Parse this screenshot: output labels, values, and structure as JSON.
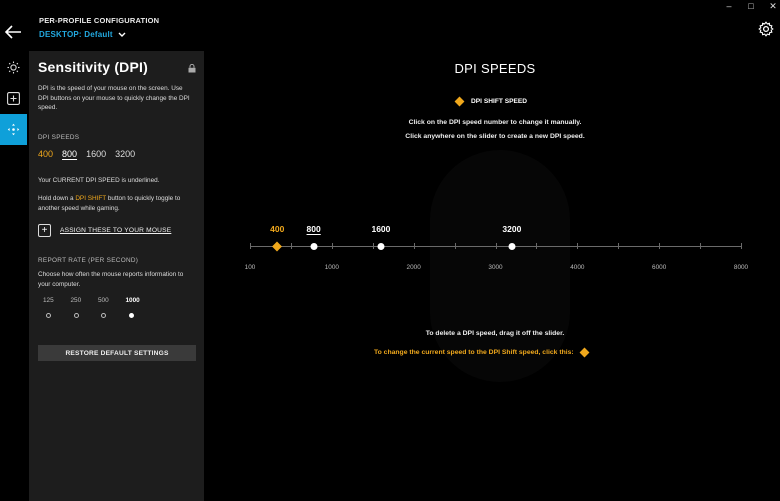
{
  "header": {
    "profile_label": "PER-PROFILE CONFIGURATION",
    "profile_name": "DESKTOP: Default",
    "window_controls": [
      "–",
      "□",
      "✕"
    ]
  },
  "rail": [
    {
      "name": "lighting",
      "icon": "sun-icon"
    },
    {
      "name": "assignments",
      "icon": "plus-square-icon"
    },
    {
      "name": "sensitivity",
      "icon": "move-arrows-icon",
      "active": true
    }
  ],
  "panel": {
    "title": "Sensitivity (DPI)",
    "description": "DPI is the speed of your mouse on the screen. Use DPI buttons on your mouse to quickly change the DPI speed.",
    "dpi_speeds_label": "DPI SPEEDS",
    "dpi_speeds": [
      "400",
      "800",
      "1600",
      "3200"
    ],
    "dpi_shift_value": "400",
    "current_dpi_value": "800",
    "current_note": "Your CURRENT DPI SPEED is underlined.",
    "hold_note_before": "Hold down a ",
    "hold_note_highlight": "DPI SHIFT",
    "hold_note_after": " button to quickly toggle to another speed while gaming.",
    "assign_label": "ASSIGN THESE TO YOUR MOUSE",
    "report_rate_label": "REPORT RATE (PER SECOND)",
    "report_rate_desc": "Choose how often the mouse reports information to your computer.",
    "report_rates": [
      "125",
      "250",
      "500",
      "1000"
    ],
    "selected_rate": "1000",
    "restore_label": "RESTORE DEFAULT SETTINGS"
  },
  "main": {
    "title": "DPI SPEEDS",
    "shift_legend": "DPI SHIFT SPEED",
    "instruction_1": "Click on the DPI speed number to change it manually.",
    "instruction_2": "Click anywhere on the slider to create a new DPI speed.",
    "delete_note": "To delete a DPI speed, drag it off the slider.",
    "shift_change_note": "To change the current speed to the DPI Shift speed, click this:"
  },
  "slider_data": {
    "axis_ticks": [
      "100",
      "1000",
      "2000",
      "3000",
      "4000",
      "6000",
      "8000"
    ],
    "handles": [
      {
        "value": "400",
        "type": "shift"
      },
      {
        "value": "800",
        "type": "current"
      },
      {
        "value": "1600",
        "type": "normal"
      },
      {
        "value": "3200",
        "type": "normal"
      }
    ]
  },
  "colors": {
    "accent_blue": "#22a9e0",
    "rail_active": "#0fa0d9",
    "shift_orange": "#f0a81c",
    "panel_bg": "#1d1d1d"
  }
}
